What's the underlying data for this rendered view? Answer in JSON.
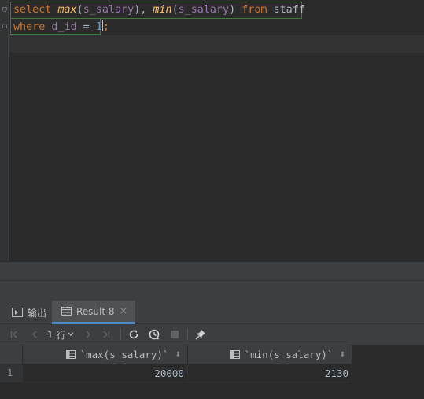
{
  "editor": {
    "line1": {
      "kw_select": "select",
      "fn_max": "max",
      "p1": "(",
      "arg1": "s_salary",
      "p2": "), ",
      "fn_min": "min",
      "p3": "(",
      "arg2": "s_salary",
      "p4": ") ",
      "kw_from": "from",
      "table": " staff"
    },
    "line2": {
      "kw_where": "where",
      "col": " d_id",
      "op": " = ",
      "num": "1",
      "semi": ";"
    }
  },
  "tabs": {
    "output": {
      "label": "输出",
      "icon": "console-icon"
    },
    "result": {
      "label": "Result 8",
      "icon": "table-icon",
      "close": "×"
    }
  },
  "toolbar": {
    "rows_label": "1 行"
  },
  "grid": {
    "columns": [
      "`max(s_salary)`",
      "`min(s_salary)`"
    ],
    "rows": [
      {
        "num": "1",
        "values": [
          "20000",
          "2130"
        ]
      }
    ]
  },
  "colors": {
    "background": "#2b2b2b",
    "panel": "#3c3f41",
    "keyword": "#cc7832",
    "function": "#ffc66d",
    "column": "#9876aa",
    "number": "#6897bb",
    "accent": "#4a88c7"
  }
}
